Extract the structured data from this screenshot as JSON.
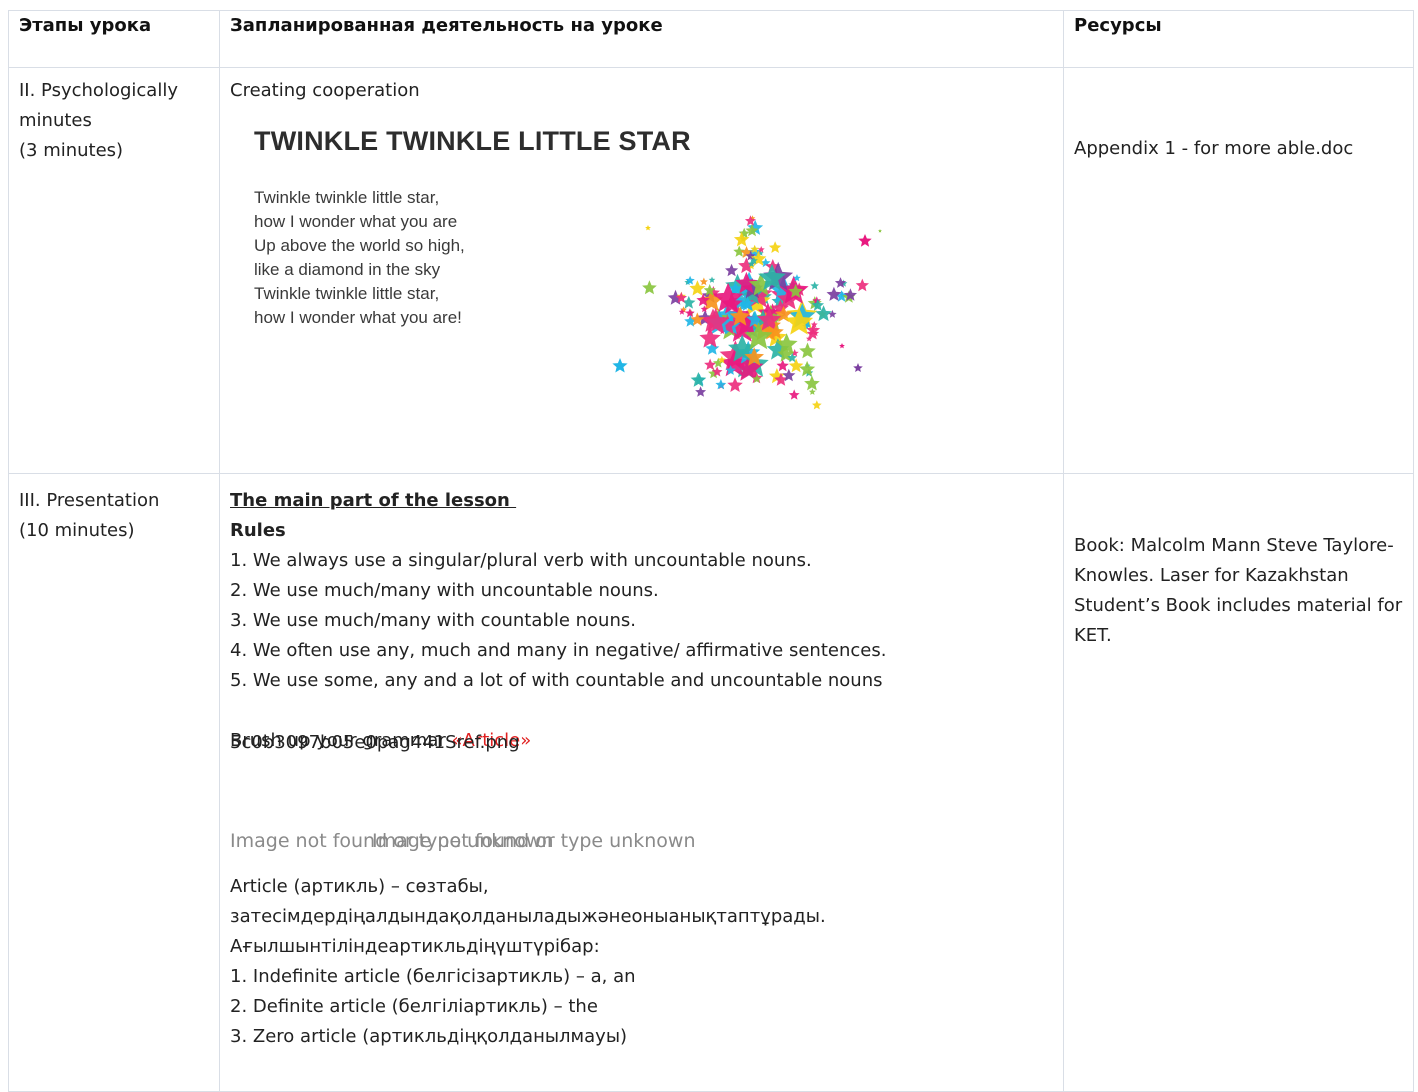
{
  "table": {
    "headers": [
      "Этапы урока",
      "Запланированная деятельность на уроке",
      "Ресурсы"
    ]
  },
  "row1": {
    "stage": "II. Psychologically minutes",
    "duration": "(3 minutes)",
    "activity": "Creating cooperation",
    "poem_title": "TWINKLE TWINKLE LITTLE STAR",
    "poem_lines": [
      "Twinkle twinkle little star,",
      "how I wonder what you are",
      "Up above the world so high,",
      "like a diamond in the sky",
      "Twinkle twinkle little star,",
      "how I wonder what you are!"
    ],
    "resource": "Appendix 1 - for more able.doc"
  },
  "row2": {
    "stage": "III. Presentation",
    "duration": "(10 minutes)",
    "heading": "The main part of the lesson ",
    "rules_label": "Rules",
    "rules": [
      "1. We always use a singular/plural verb with uncountable nouns.",
      "2. We use much/many with uncountable nouns.",
      "3. We use much/many with countable nouns.",
      "4. We often use any, much and many in negative/ affirmative sentences.",
      "5. We use some, any and a lot of with countable and uncountable nouns"
    ],
    "overlap_text_a": "Brush up your grammar ",
    "overlap_link": "«Article»",
    "overlap_text_b": "5c0b3097b05e0pag441Sref.png",
    "image_missing_a": "Image not found or type unknown",
    "image_missing_b": "Image not found or type unknown",
    "article_def_1": "Article (артикль) – сөзтабы,",
    "article_def_2": "затесімдердіңалдындақолданыладыжәнеоныанықтаптұрады.",
    "article_def_3": "Ағылшынтіліндеартикльдіңүштүрібар:",
    "article_types": [
      "1. Indefinite article (белгісізартикль) – a, an",
      "2. Definite article (белгіліартикль) – the",
      "3. Zero article (артикльдіңқолданылмауы)"
    ],
    "resource": "Book: Malcolm Mann Steve Taylore- Knowles. Laser for Kazakhstan Student’s Book includes material for KET."
  }
}
